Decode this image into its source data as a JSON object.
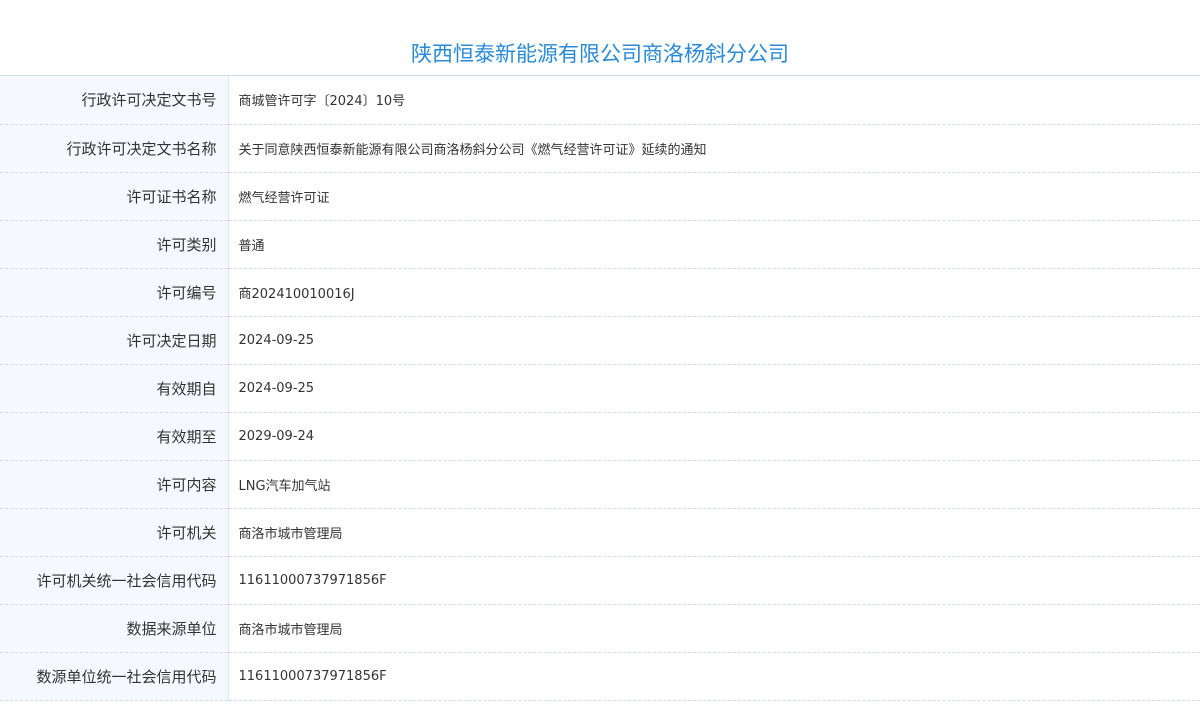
{
  "page": {
    "title": "陕西恒泰新能源有限公司商洛杨斜分公司"
  },
  "rows": [
    {
      "label": "行政许可决定文书号",
      "value": "商城管许可字〔2024〕10号"
    },
    {
      "label": "行政许可决定文书名称",
      "value": "关于同意陕西恒泰新能源有限公司商洛杨斜分公司《燃气经营许可证》延续的通知"
    },
    {
      "label": "许可证书名称",
      "value": "燃气经营许可证"
    },
    {
      "label": "许可类别",
      "value": "普通"
    },
    {
      "label": "许可编号",
      "value": "商202410010016J"
    },
    {
      "label": "许可决定日期",
      "value": "2024-09-25"
    },
    {
      "label": "有效期自",
      "value": "2024-09-25"
    },
    {
      "label": "有效期至",
      "value": "2029-09-24"
    },
    {
      "label": "许可内容",
      "value": "LNG汽车加气站"
    },
    {
      "label": "许可机关",
      "value": "商洛市城市管理局"
    },
    {
      "label": "许可机关统一社会信用代码",
      "value": "11611000737971856F"
    },
    {
      "label": "数据来源单位",
      "value": "商洛市城市管理局"
    },
    {
      "label": "数源单位统一社会信用代码",
      "value": "11611000737971856F"
    }
  ],
  "colors": {
    "title": "#2a8ad6",
    "label_bg": "#f5f9fe",
    "border": "#cfdbe8"
  }
}
